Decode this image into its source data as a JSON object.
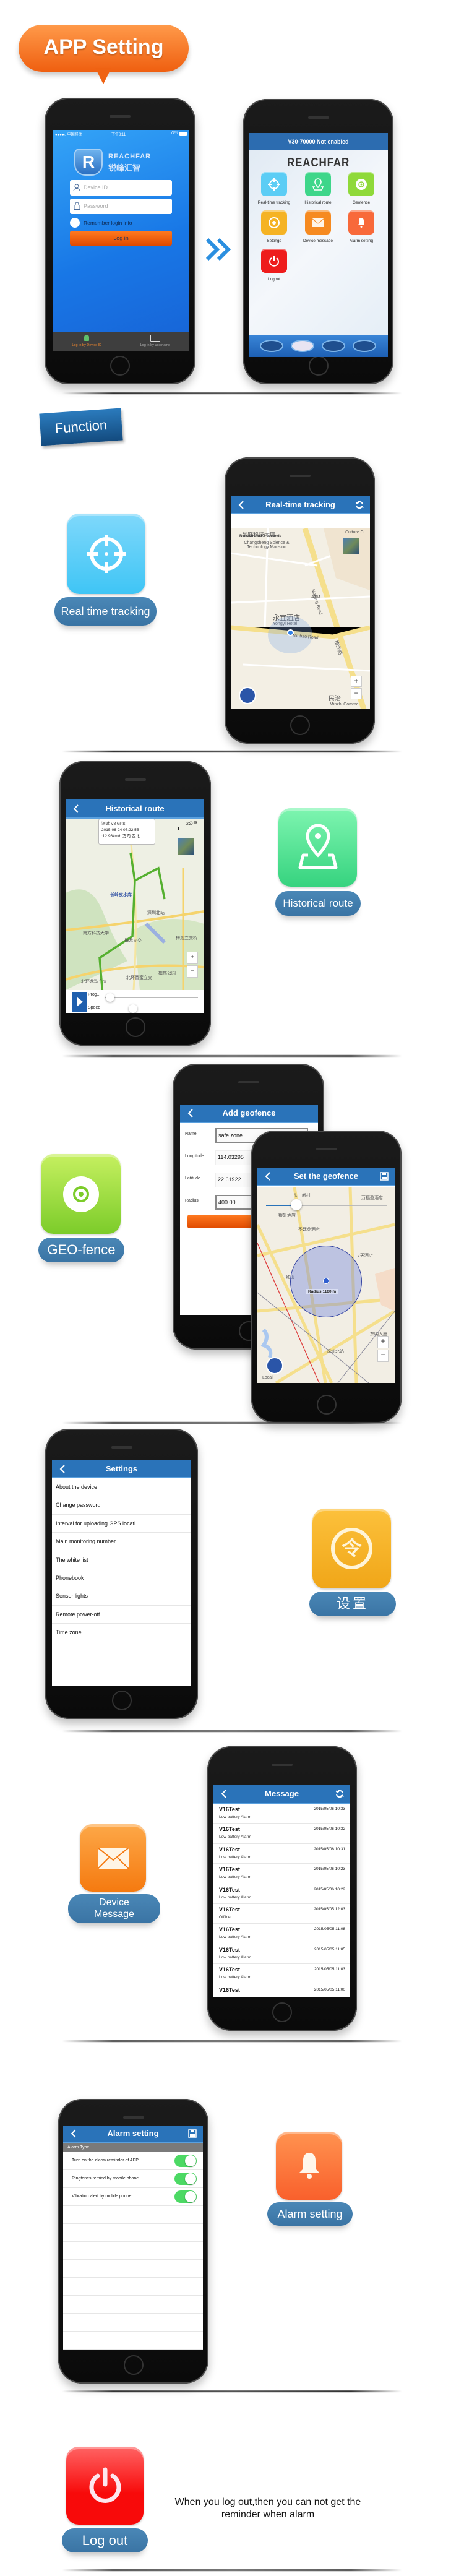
{
  "colors": {
    "accent_blue": "#2a73b9",
    "label_pill": "#3f7cab",
    "title_orange": "#f26b1d",
    "function_tag": "#1d5f97"
  },
  "banner": {
    "title": "APP Setting"
  },
  "login_screen": {
    "status": {
      "carrier": "●●●●○ 中国移动",
      "time": "下午8:11",
      "battery": "79%"
    },
    "logo": {
      "brand": "REACHFAR",
      "brand_cn": "锐峰汇智"
    },
    "device_id_placeholder": "Device ID",
    "password_placeholder": "Password",
    "remember": "Remember login info",
    "login_button": "Log in",
    "tabs": [
      {
        "label": "Log in by Device ID",
        "active": true,
        "icon": "person-icon"
      },
      {
        "label": "Log in by username",
        "active": false,
        "icon": "id-card-icon"
      }
    ]
  },
  "home_screen": {
    "header": "V30-70000 Not enabled",
    "logo": "REACHFAR",
    "items": [
      {
        "label": "Real-time tracking",
        "icon": "crosshair-icon",
        "color": "#5ccdf5"
      },
      {
        "label": "Historical route",
        "icon": "map-pin-icon",
        "color": "#3ed68a"
      },
      {
        "label": "Geofence",
        "icon": "target-icon",
        "color": "#8fd93a"
      },
      {
        "label": "Settings",
        "icon": "settings-coin-icon",
        "color": "#f5b324"
      },
      {
        "label": "Device message",
        "icon": "envelope-icon",
        "color": "#f68a20"
      },
      {
        "label": "Alarm setting",
        "icon": "bell-icon",
        "color": "#f8693a"
      },
      {
        "label": "Logout",
        "icon": "power-icon",
        "color": "#ee1c1c"
      }
    ]
  },
  "function_tag": "Function",
  "realtime": {
    "feature_label": "Real time tracking",
    "title": "Real-time tracking",
    "map_labels": {
      "refresh": "Refresh after 7 seconds",
      "poi_cn": "昌盛科技大厦",
      "poi": "Changsheng Science & Technology Mansion",
      "culture": "Culture C",
      "atm": "ATM",
      "road1": "Meilong Road",
      "hotel_cn": "永宜酒店",
      "hotel": "Yongyi Hotel",
      "road2": "Minbao Road",
      "road_cn": "梅龙路",
      "bottom_cn": "民治",
      "bottom": "Minzhi Comme"
    }
  },
  "historical": {
    "feature_label": "Historical route",
    "title": "Historical route",
    "popup": {
      "line1": "测试-V8  GPS",
      "line2": "2015-06-24 07:22:55",
      "line3": ":12.96km/h 方向:西北"
    },
    "scale": "2公里",
    "map_labels": {
      "a": "长岭皮水库",
      "b": "深圳北站",
      "c": "南方科技大学",
      "d": "梅龙立交",
      "e": "北环龙珠立交",
      "f": "北环香蜜立交",
      "g": "梅林公园",
      "h": "梅观立交桥"
    },
    "controls": {
      "progress_label": "Prog...",
      "speed_label": "Speed",
      "progress": 0.05,
      "speed": 0.3
    }
  },
  "geofence": {
    "feature_label": "GEO-fence",
    "add_title": "Add geofence",
    "fields": [
      {
        "label": "Name",
        "value": "safe zone"
      },
      {
        "label": "Longitude",
        "value": "114.03295"
      },
      {
        "label": "Latitude",
        "value": "22.61922"
      },
      {
        "label": "Radius",
        "value": "400.00"
      }
    ],
    "set_title": "Set the geofence",
    "radius_label": "Radius 1100 m",
    "local_label": "Local",
    "map_labels": {
      "a": "东一新村",
      "b": "银轩酒店",
      "c": "圣廷苑酒店",
      "d": "红山",
      "e": "深圳北站",
      "f": "7天酒店",
      "g": "万福盈酒店",
      "h": "东明大厦"
    }
  },
  "settings": {
    "feature_label": "设置",
    "icon_glyph": "令",
    "title": "Settings",
    "items": [
      "About the device",
      "Change password",
      "Interval for uploading GPS locati...",
      "Main monitoring number",
      "The white list",
      "Phonebook",
      "Sensor lights",
      "Remote power-off",
      "Time zone"
    ]
  },
  "messages": {
    "feature_label_1": "Device",
    "feature_label_2": "Message",
    "title": "Message",
    "items": [
      {
        "device": "V16Test",
        "text": "Low battery Alarm",
        "time": "2015/05/06 10:33"
      },
      {
        "device": "V16Test",
        "text": "Low battery Alarm",
        "time": "2015/05/06 10:32"
      },
      {
        "device": "V16Test",
        "text": "Low battery Alarm",
        "time": "2015/05/06 10:31"
      },
      {
        "device": "V16Test",
        "text": "Low battery Alarm",
        "time": "2015/05/06 10:23"
      },
      {
        "device": "V16Test",
        "text": "Low battery Alarm",
        "time": "2015/05/06 10:22"
      },
      {
        "device": "V16Test",
        "text": "Offline",
        "time": "2015/05/05 12:03"
      },
      {
        "device": "V16Test",
        "text": "Low battery Alarm",
        "time": "2015/05/05 11:08"
      },
      {
        "device": "V16Test",
        "text": "Low battery Alarm",
        "time": "2015/05/05 11:05"
      },
      {
        "device": "V16Test",
        "text": "Low battery Alarm",
        "time": "2015/05/05 11:03"
      },
      {
        "device": "V16Test",
        "text": "",
        "time": "2015/05/05 11:00"
      }
    ]
  },
  "alarm": {
    "feature_label": "Alarm setting",
    "title": "Alarm setting",
    "section": "Alarm Type",
    "items": [
      {
        "label": "Turn on the alarm reminder of APP",
        "on": true
      },
      {
        "label": "Ringtones remind by mobile phone",
        "on": true
      },
      {
        "label": "Vibration alert by mobile phone",
        "on": true
      }
    ]
  },
  "logout": {
    "feature_label": "Log out",
    "note": "When you log out,then you can not get the reminder when alarm"
  }
}
